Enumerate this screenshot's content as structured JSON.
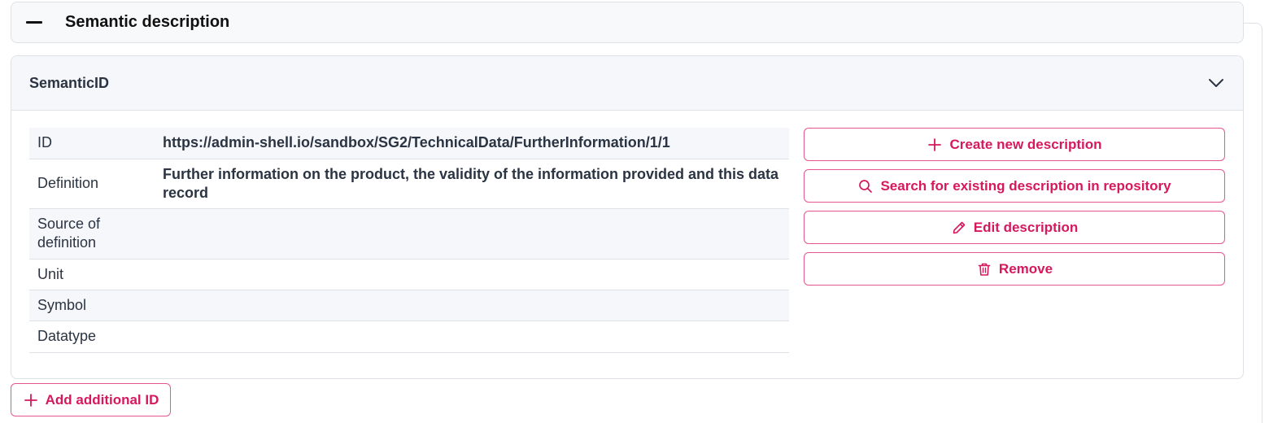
{
  "section": {
    "title": "Semantic description"
  },
  "card": {
    "title": "SemanticID"
  },
  "table": {
    "rows": [
      {
        "key": "ID",
        "value": "https://admin-shell.io/sandbox/SG2/TechnicalData/FurtherInformation/1/1"
      },
      {
        "key": "Definition",
        "value": "Further information on the product, the validity of the information provided and this data record"
      },
      {
        "key": "Source of definition",
        "value": ""
      },
      {
        "key": "Unit",
        "value": ""
      },
      {
        "key": "Symbol",
        "value": ""
      },
      {
        "key": "Datatype",
        "value": ""
      }
    ]
  },
  "actions": {
    "create": {
      "label": "Create new description",
      "icon": "plus-icon"
    },
    "search": {
      "label": "Search for existing description in repository",
      "icon": "search-icon"
    },
    "edit": {
      "label": "Edit description",
      "icon": "pencil-icon"
    },
    "remove": {
      "label": "Remove",
      "icon": "trash-icon"
    }
  },
  "add_id": {
    "label": "Add additional ID",
    "icon": "plus-icon"
  },
  "colors": {
    "accent": "#d6185d",
    "accent_border": "#e7558f"
  }
}
